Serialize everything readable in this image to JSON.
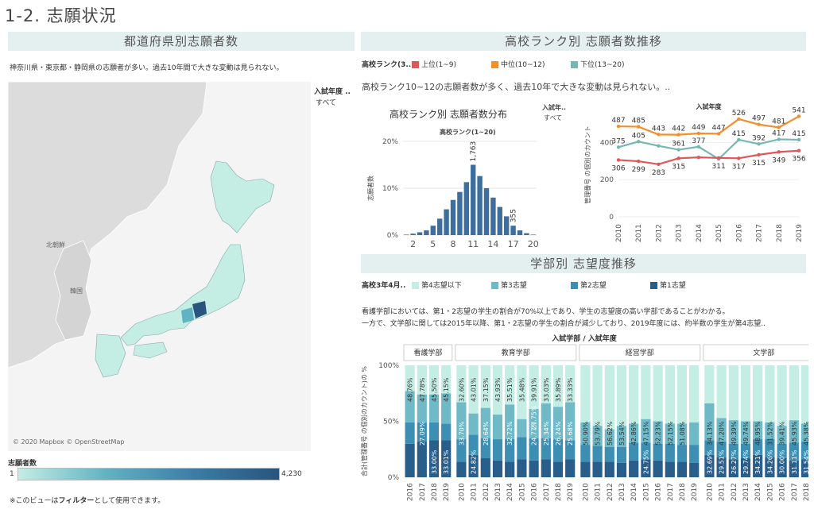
{
  "page_title": "1-2. 志願状況",
  "left": {
    "header": "都道府県別志願者数",
    "note": "神奈川県・東京都・静岡県の志願者が多い。過去10年間で大きな変動は見られない。",
    "filter_label": "入試年度 ..",
    "filter_value": "すべて",
    "map_labels": {
      "north_korea": "北朝鮮",
      "south_korea": "韓国"
    },
    "attribution": "© 2020 Mapbox © OpenStreetMap",
    "scale_title": "志願者数",
    "scale_min": "1",
    "scale_max": "4,230",
    "footer_prefix": "※このビューは",
    "footer_bold": "フィルター",
    "footer_suffix": "として使用できます。",
    "colors": {
      "map_low": "#c4ede4",
      "map_high": "#28547d",
      "map_mid": "#9fd6d2"
    }
  },
  "rank": {
    "header": "高校ランク別 志願者数推移",
    "legend_label": "高校ランク(3..",
    "legend": [
      {
        "label": "上位(1~9)",
        "color": "#e15759"
      },
      {
        "label": "中位(10~12)",
        "color": "#f28e2b"
      },
      {
        "label": "下位(13~20)",
        "color": "#76b7b2"
      }
    ],
    "note": "高校ランク10~12の志願者数が多く、過去10年で大きな変動は見られない。.."
  },
  "faculty": {
    "header": "学部別 志望度推移",
    "legend_label": "高校3年4月..",
    "legend": [
      {
        "label": "第4志望以下",
        "color": "#c4ede4"
      },
      {
        "label": "第3志望",
        "color": "#6fbac6"
      },
      {
        "label": "第2志望",
        "color": "#3c8fb2"
      },
      {
        "label": "第1志望",
        "color": "#2a5e8a"
      }
    ],
    "note1": "看護学部においては、第1・2志望の学生の割合が70%以上であり、学生の志望度の高い学部であることがわかる。",
    "note2": "一方で、文学部に関しては2015年以降、第1・2志望の学生の割合が減少しており、2019年度には、約半数の学生が第4志望.."
  },
  "chart_data": [
    {
      "type": "bar",
      "title": "高校ランク別 志願者数分布",
      "subtitle": "高校ランク(1~20)",
      "ylabel": "志願者数",
      "filter_label": "入試年..",
      "filter_value": "すべて",
      "x": [
        1,
        2,
        3,
        4,
        5,
        6,
        7,
        8,
        9,
        10,
        11,
        12,
        13,
        14,
        15,
        16,
        17,
        18,
        19,
        20
      ],
      "values": [
        0.1,
        0.3,
        0.6,
        1.0,
        2.0,
        3.5,
        5.5,
        7.5,
        9.2,
        11.3,
        15.0,
        12.6,
        10.0,
        8.0,
        6.0,
        4.0,
        2.0,
        1.0,
        0.4,
        0.1
      ],
      "xticks": [
        2,
        5,
        8,
        11,
        14,
        17,
        20
      ],
      "yticks": [
        "0%",
        "10%",
        "20%"
      ],
      "ylim": [
        0,
        20
      ],
      "data_labels": [
        {
          "x": 11,
          "text": "1,763"
        },
        {
          "x": 17,
          "text": "355"
        }
      ],
      "color": "#3d6e9e"
    },
    {
      "type": "line",
      "title": "入試年度",
      "ylabel": "管理番号 の個別のカウント",
      "x": [
        "2010",
        "2011",
        "2012",
        "2013",
        "2014",
        "2015",
        "2016",
        "2017",
        "2018",
        "2019"
      ],
      "yticks": [
        0,
        200,
        400
      ],
      "ylim": [
        0,
        560
      ],
      "series": [
        {
          "name": "中位(10~12)",
          "color": "#f28e2b",
          "values": [
            487,
            485,
            443,
            442,
            449,
            447,
            526,
            497,
            481,
            541
          ]
        },
        {
          "name": "下位(13~20)",
          "color": "#76b7b2",
          "values": [
            375,
            405,
            382,
            361,
            377,
            311,
            415,
            392,
            417,
            415
          ]
        },
        {
          "name": "上位(1~9)",
          "color": "#e15759",
          "values": [
            306,
            299,
            283,
            315,
            320,
            317,
            315,
            334,
            349,
            356
          ]
        }
      ],
      "labels": {
        "中位(10~12)": [
          "487",
          "485",
          "443",
          "442",
          "449",
          "447",
          "526",
          "497",
          "481",
          "541"
        ],
        "下位(13~20)": [
          "375",
          "405",
          "",
          "361",
          "377",
          "",
          "415",
          "392",
          "417",
          "415"
        ],
        "上位(1~9)": [
          "306",
          "299",
          "283",
          "315",
          "",
          "311",
          "317",
          "315",
          "349",
          "356"
        ]
      }
    },
    {
      "type": "bar",
      "stacked": true,
      "title": "入試学部 / 入試年度",
      "ylabel": "合計(管理番号 の個別のカウント)の %",
      "yticks": [
        "0%",
        "50%",
        "100%"
      ],
      "groups": [
        {
          "name": "看護学部",
          "years": [
            "2016",
            "2017",
            "2018",
            "2019"
          ],
          "s1": [
            30,
            32,
            33,
            33
          ],
          "s2": [
            19,
            17,
            16,
            15
          ],
          "s3": [
            28,
            25,
            25,
            27
          ]
        },
        {
          "name": "教育学部",
          "years": [
            "2010",
            "2011",
            "2012",
            "2013",
            "2014",
            "2015",
            "2016",
            "2017",
            "2018",
            "2019"
          ],
          "s1": [
            14,
            20,
            17,
            15,
            14,
            16,
            15,
            16,
            14,
            16
          ],
          "s2": [
            20,
            18,
            18,
            19,
            20,
            20,
            20,
            19,
            20,
            17
          ],
          "s3": [
            33,
            19,
            27,
            22,
            31,
            16,
            26,
            31,
            29,
            34
          ]
        },
        {
          "name": "経営学部",
          "years": [
            "2010",
            "2011",
            "2012",
            "2013",
            "2014",
            "2015",
            "2016",
            "2017",
            "2018",
            "2019"
          ],
          "s1": [
            14,
            14,
            14,
            13,
            15,
            16,
            15,
            14,
            14,
            13
          ],
          "s2": [
            15,
            14,
            13,
            14,
            16,
            15,
            15,
            16,
            15,
            16
          ],
          "s3": [
            20,
            18,
            16,
            19,
            17,
            21,
            20,
            18,
            19,
            20
          ]
        },
        {
          "name": "文学部",
          "years": [
            "2010",
            "2011",
            "2012",
            "2013",
            "2014",
            "2015",
            "2016",
            "2017",
            "2018",
            "2019"
          ],
          "s1": [
            20,
            18,
            16,
            17,
            20,
            18,
            17,
            15,
            16,
            14
          ],
          "s2": [
            13,
            14,
            14,
            13,
            14,
            16,
            13,
            16,
            16,
            16
          ],
          "s3": [
            33,
            21,
            21,
            20,
            16,
            15,
            16,
            20,
            16,
            17
          ]
        }
      ],
      "labels": {
        "看護学部": [
          [
            "",
            "",
            "33.00%",
            "33.01%"
          ],
          [
            "",
            "27.09%",
            "",
            ""
          ],
          [
            "48.76%",
            "47.78%",
            "45.50%",
            "45.15%"
          ]
        ],
        "教育学部": [
          [
            "",
            "24.82%",
            "",
            "",
            "",
            "",
            "",
            "",
            "",
            ""
          ],
          [
            "33.70%",
            "",
            "28.64%",
            "",
            "32.72%",
            "",
            "24.77%",
            "25.34%",
            "26.24%",
            "25.68%"
          ],
          [
            "32.60%",
            "43.01%",
            "37.15%",
            "43.93%",
            "35.51%",
            "35.48%",
            "39.91%",
            "33.03%",
            "35.89%",
            "33.33%"
          ],
          [
            "",
            "",
            "",
            "",
            "",
            "",
            "27.75%",
            "",
            "",
            ""
          ]
        ],
        "経営学部": [
          [
            "",
            "",
            "",
            "",
            "",
            "24.75%",
            "",
            "",
            "",
            ""
          ],
          [
            "50.90%",
            "53.79%",
            "56.62%",
            "53.54%",
            "42.86%",
            "47.15%",
            "52.23%",
            "52.15%",
            "51.08%",
            ""
          ]
        ],
        "文学部": [
          [
            "32.69%",
            "29.51%",
            "26.27%",
            "29.74%",
            "34.21%",
            "34.26%",
            "30.00%",
            "31.11%",
            "31.54%",
            "30.25%"
          ],
          [
            "34.13%",
            "47.20%",
            "49.39%",
            "49.74%",
            "48.95%",
            "31.52%",
            "39.41%",
            "45.93%",
            "45.38%",
            "52.94%"
          ]
        ]
      }
    }
  ]
}
